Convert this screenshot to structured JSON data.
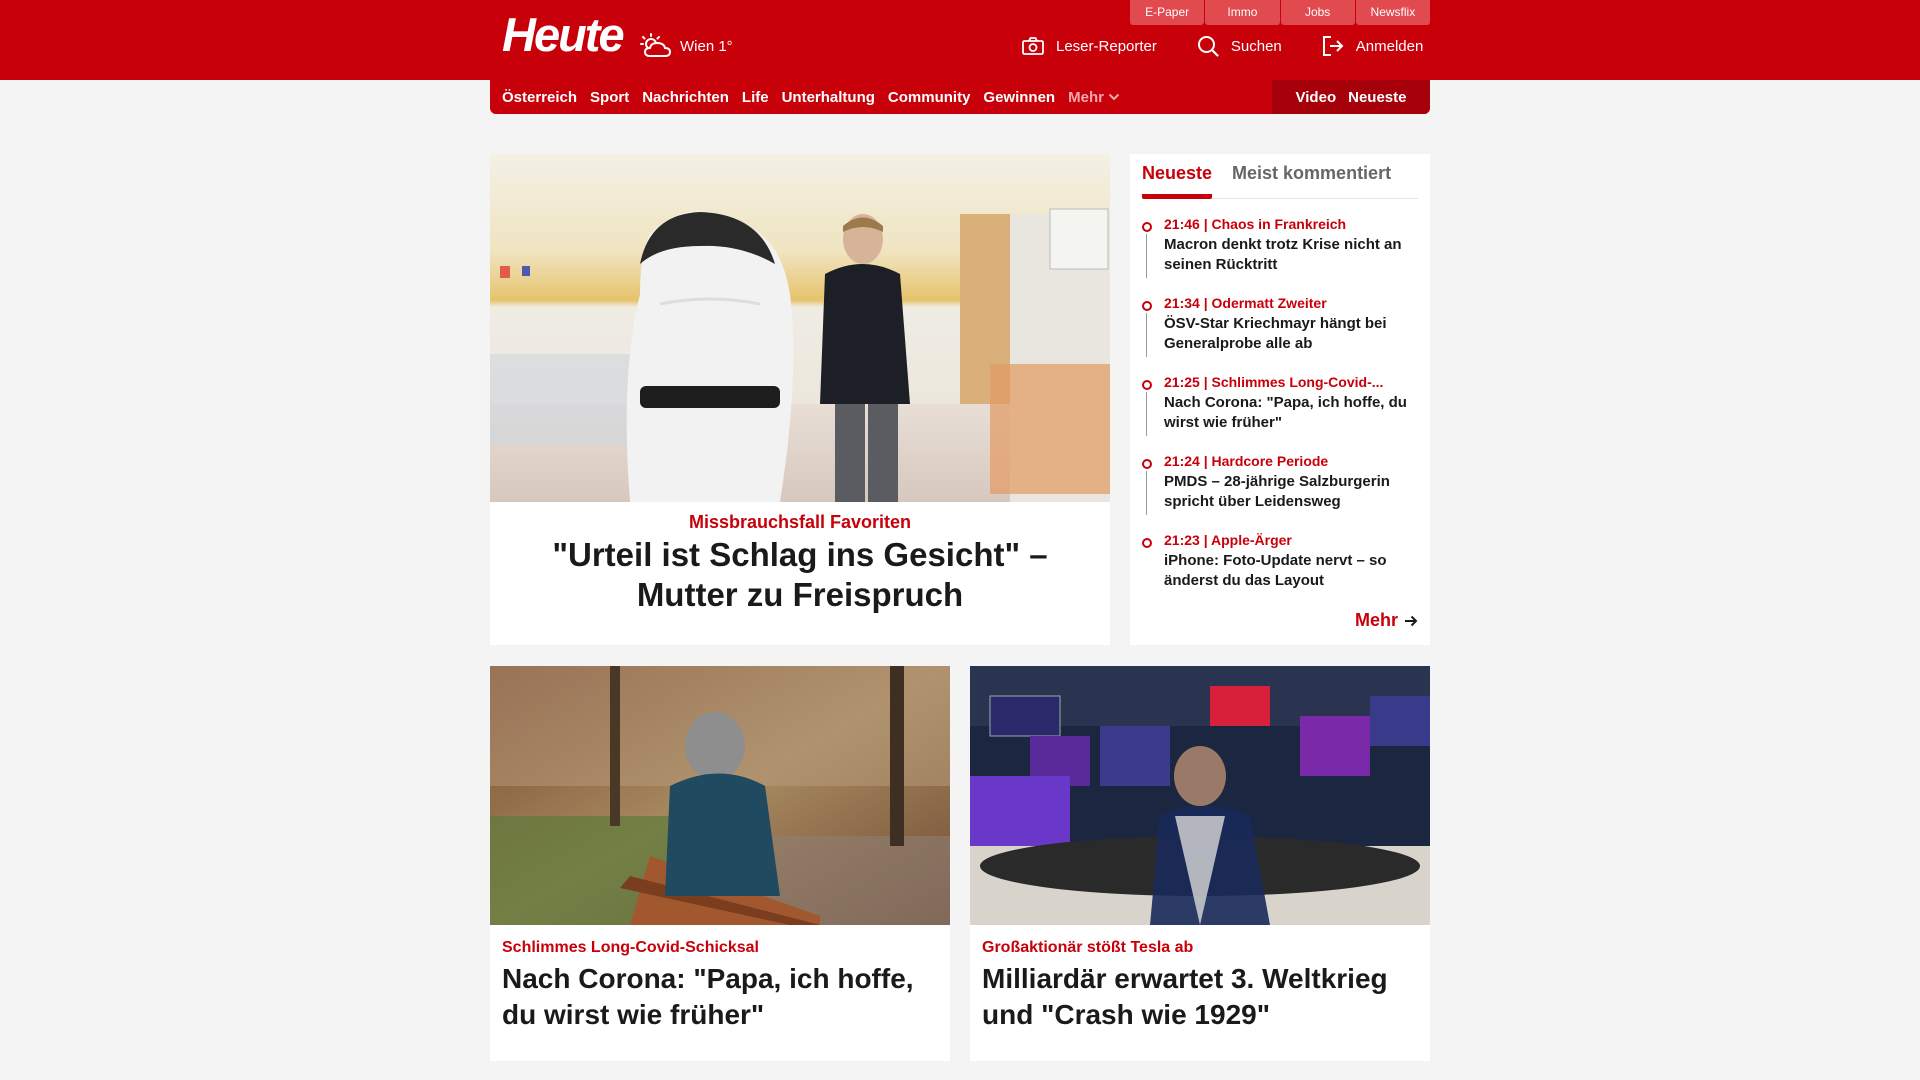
{
  "header": {
    "logo": "Heute",
    "weather": "Wien 1°",
    "service_links": [
      "E-Paper",
      "Immo",
      "Jobs",
      "Newsflix"
    ],
    "actions": {
      "reporter": "Leser-Reporter",
      "search": "Suchen",
      "login": "Anmelden"
    }
  },
  "nav": {
    "items": [
      "Österreich",
      "Sport",
      "Nachrichten",
      "Life",
      "Unterhaltung",
      "Community",
      "Gewinnen"
    ],
    "more": "Mehr",
    "right": [
      "Video",
      "Neueste"
    ]
  },
  "hero": {
    "kicker": "Missbrauchsfall Favoriten",
    "title": "\"Urteil ist Schlag ins Gesicht\" – Mutter zu Freispruch"
  },
  "sidebar": {
    "tabs": [
      "Neueste",
      "Meist kommentiert"
    ],
    "active_tab": "Neueste",
    "items": [
      {
        "meta": "21:46 | Chaos in Frankreich",
        "title": "Macron denkt trotz Krise nicht an seinen Rücktritt"
      },
      {
        "meta": "21:34 | Odermatt Zweiter",
        "title": "ÖSV-Star Kriechmayr hängt bei Generalprobe alle ab"
      },
      {
        "meta": "21:25 | Schlimmes Long-Covid-...",
        "title": "Nach Corona: \"Papa, ich hoffe, du wirst wie früher\""
      },
      {
        "meta": "21:24 | Hardcore Periode",
        "title": "PMDS – 28-jährige Salzburgerin spricht über Leidensweg"
      },
      {
        "meta": "21:23 | Apple-Ärger",
        "title": "iPhone: Foto-Update nervt – so änderst du das Layout"
      }
    ],
    "more": "Mehr"
  },
  "cards": [
    {
      "kicker": "Schlimmes Long-Covid-Schicksal",
      "title": "Nach Corona: \"Papa, ich hoffe, du wirst wie früher\""
    },
    {
      "kicker": "Großaktionär stößt Tesla ab",
      "title": "Milliardär erwartet 3. Weltkrieg und \"Crash wie 1929\""
    }
  ],
  "colors": {
    "brand": "#c8000a",
    "background": "#f4f4f4"
  }
}
